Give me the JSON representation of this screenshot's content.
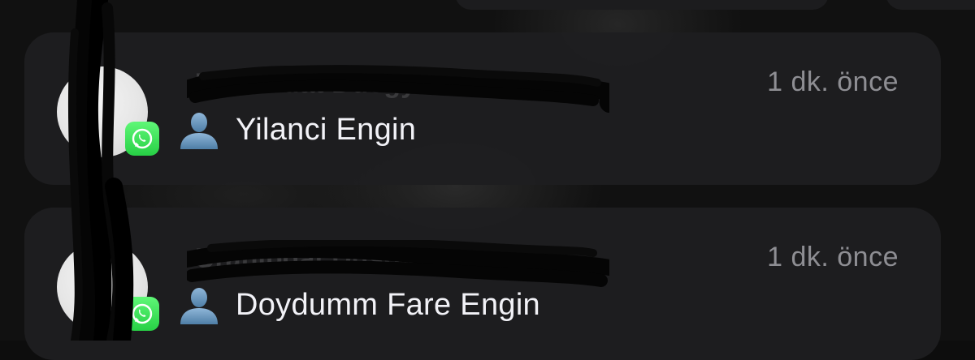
{
  "notifications": [
    {
      "app": "whatsapp-icon",
      "sender_ghost": "Uranibdat Dusgyin",
      "timestamp": "1 dk. önce",
      "body_icon": "person-silhouette-icon",
      "body_text": "Yilanci Engin"
    },
    {
      "app": "whatsapp-icon",
      "sender_ghost": "Uranibdat Dusgyin",
      "timestamp": "1 dk. önce",
      "body_icon": "person-silhouette-icon",
      "body_text": "Doydumm Fare Engin"
    }
  ],
  "colors": {
    "card": "#1e1e20",
    "timestamp": "#8e8e93",
    "text": "#f2f2f7",
    "whatsapp": "#27d045"
  }
}
